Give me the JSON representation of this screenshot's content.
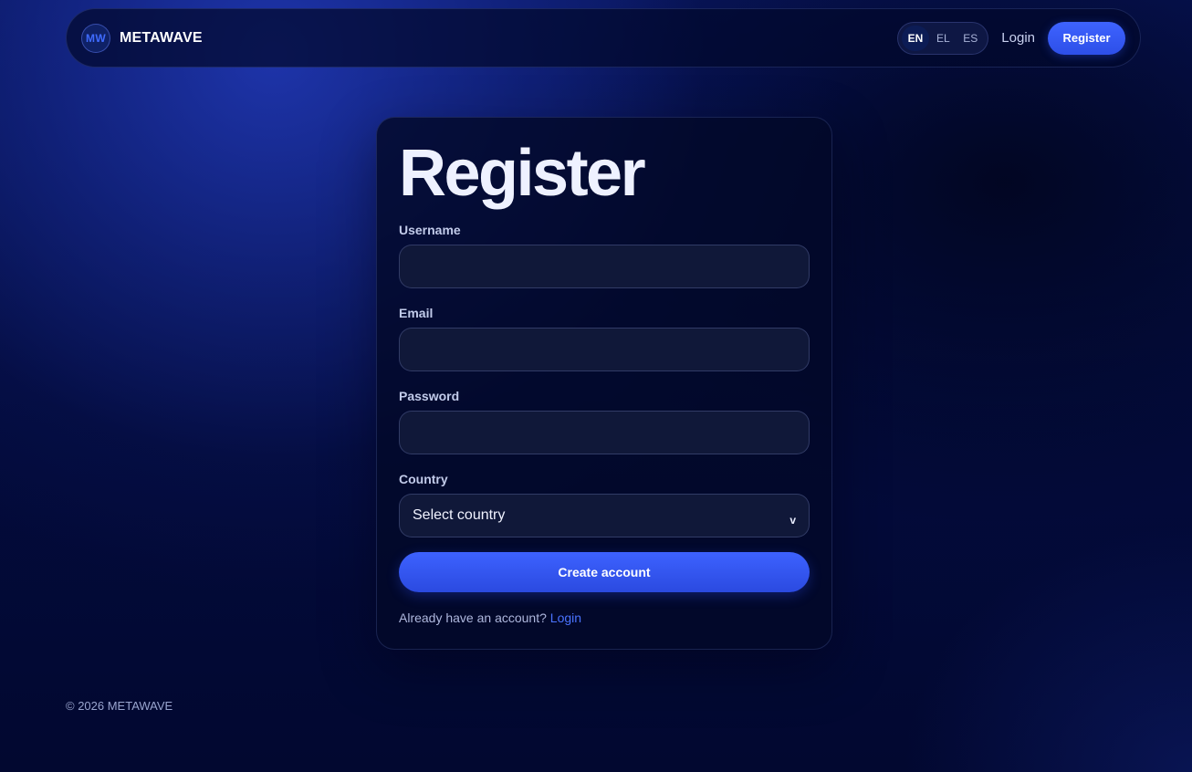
{
  "header": {
    "logo_text": "MW",
    "brand_name": "METAWAVE",
    "languages": [
      {
        "code": "EN",
        "active": true
      },
      {
        "code": "EL",
        "active": false
      },
      {
        "code": "ES",
        "active": false
      }
    ],
    "login_label": "Login",
    "register_label": "Register"
  },
  "form": {
    "title": "Register",
    "username_label": "Username",
    "username_value": "",
    "email_label": "Email",
    "email_value": "",
    "password_label": "Password",
    "password_value": "",
    "country_label": "Country",
    "country_selected": "Select country",
    "country_chevron": "v",
    "submit_label": "Create account",
    "login_prompt": "Already have an account?",
    "login_link": "Login"
  },
  "footer": {
    "copyright": "© 2026 METAWAVE"
  },
  "colors": {
    "accent": "#3e63ff",
    "link": "#4a73ff",
    "background": "#020a33"
  }
}
